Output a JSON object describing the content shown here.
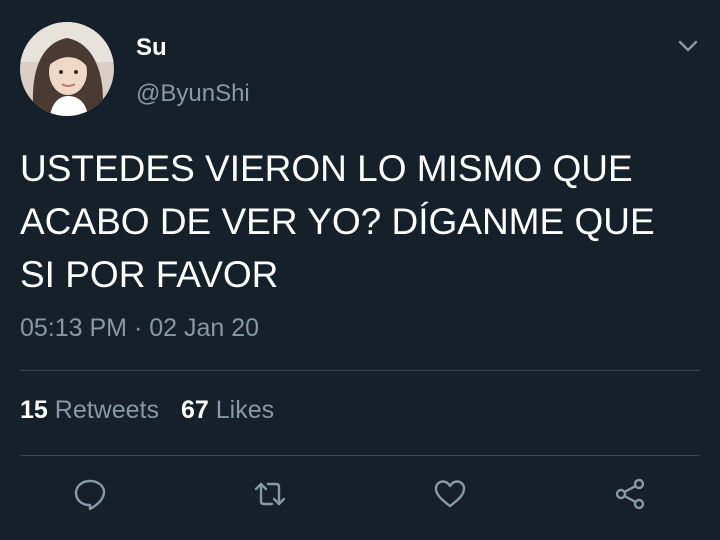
{
  "user": {
    "display_name": "Su",
    "handle": "@ByunShi"
  },
  "tweet": {
    "text": "USTEDES VIERON LO MISMO QUE\nACABO DE VER YO? DÍGANME QUE\nSI POR FAVOR",
    "timestamp": "05:13 PM · 02 Jan 20"
  },
  "stats": {
    "retweets_count": "15",
    "retweets_label": "Retweets",
    "likes_count": "67",
    "likes_label": "Likes"
  },
  "actions": [
    "reply-icon",
    "retweet-icon",
    "like-icon",
    "share-icon"
  ],
  "colors": {
    "background": "#15202b",
    "text_primary": "#ffffff",
    "text_secondary": "#8899a6",
    "divider": "#38444d"
  }
}
